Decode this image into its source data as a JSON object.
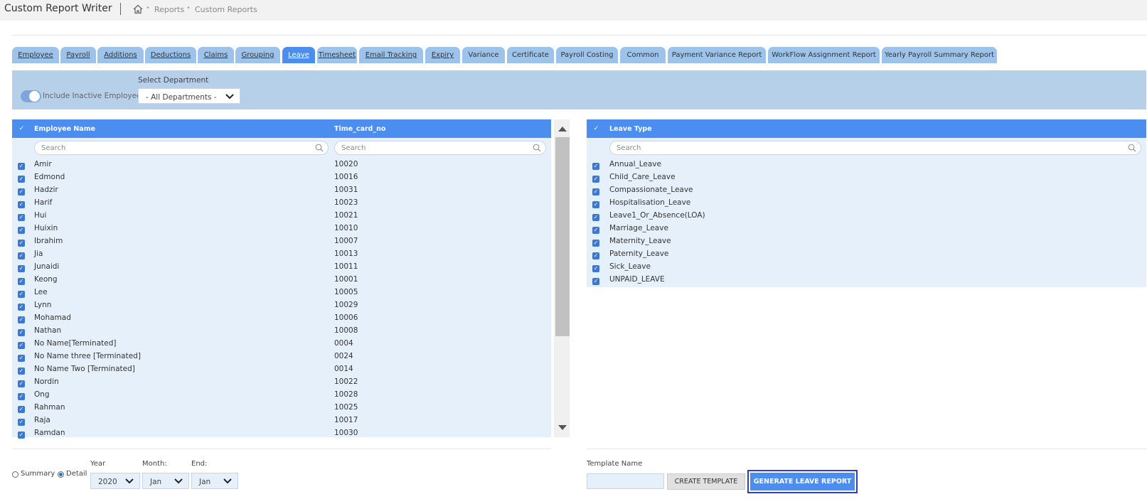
{
  "header": {
    "app_title": "Custom Report Writer",
    "breadcrumb": [
      "Reports",
      "Custom Reports"
    ]
  },
  "tabs": [
    {
      "label": "Employee",
      "active": false
    },
    {
      "label": "Payroll",
      "active": false
    },
    {
      "label": "Additions",
      "active": false
    },
    {
      "label": "Deductions",
      "active": false
    },
    {
      "label": "Claims",
      "active": false
    },
    {
      "label": "Grouping",
      "active": false
    },
    {
      "label": "Leave",
      "active": true
    },
    {
      "label": "Timesheet",
      "active": false
    },
    {
      "label": "Email Tracking",
      "active": false
    },
    {
      "label": "Expiry",
      "active": false
    },
    {
      "label": "Variance",
      "active": false
    },
    {
      "label": "Certificate",
      "active": false
    },
    {
      "label": "Payroll Costing",
      "active": false
    },
    {
      "label": "Common",
      "active": false
    },
    {
      "label": "Payment Variance Report",
      "active": false
    },
    {
      "label": "WorkFlow Assignment Report",
      "active": false
    },
    {
      "label": "Yearly Payroll Summary Report",
      "active": false
    }
  ],
  "filters": {
    "include_inactive_label": "Include Inactive Employee",
    "include_inactive_on": true,
    "department_label": "Select Department",
    "department_value": "- All Departments -"
  },
  "employee_table": {
    "col_name": "Employee Name",
    "col_timecard": "Time_card_no",
    "search_placeholder": "Search",
    "rows": [
      {
        "name": "Amir",
        "time_card": "10020"
      },
      {
        "name": "Edmond",
        "time_card": "10016"
      },
      {
        "name": "Hadzir",
        "time_card": "10031"
      },
      {
        "name": "Harif",
        "time_card": "10023"
      },
      {
        "name": "Hui",
        "time_card": "10021"
      },
      {
        "name": "Huixin",
        "time_card": "10010"
      },
      {
        "name": "Ibrahim",
        "time_card": "10007"
      },
      {
        "name": "Jia",
        "time_card": "10013"
      },
      {
        "name": "Junaidi",
        "time_card": "10011"
      },
      {
        "name": "Keong",
        "time_card": "10001"
      },
      {
        "name": "Lee",
        "time_card": "10005"
      },
      {
        "name": "Lynn",
        "time_card": "10029"
      },
      {
        "name": "Mohamad",
        "time_card": "10006"
      },
      {
        "name": "Nathan",
        "time_card": "10008"
      },
      {
        "name": "No Name[Terminated]",
        "time_card": "0004"
      },
      {
        "name": "No Name three [Terminated]",
        "time_card": "0024"
      },
      {
        "name": "No Name Two [Terminated]",
        "time_card": "0014"
      },
      {
        "name": "Nordin",
        "time_card": "10022"
      },
      {
        "name": "Ong",
        "time_card": "10028"
      },
      {
        "name": "Rahman",
        "time_card": "10025"
      },
      {
        "name": "Raja",
        "time_card": "10017"
      },
      {
        "name": "Ramdan",
        "time_card": "10030"
      }
    ]
  },
  "leave_table": {
    "col_type": "Leave Type",
    "search_placeholder": "Search",
    "rows": [
      "Annual_Leave",
      "Child_Care_Leave",
      "Compassionate_Leave",
      "Hospitalisation_Leave",
      "Leave1_Or_Absence(LOA)",
      "Marriage_Leave",
      "Maternity_Leave",
      "Paternity_Leave",
      "Sick_Leave",
      "UNPAID_LEAVE"
    ]
  },
  "report_options": {
    "summary_label": "Summary",
    "detail_label": "Detail",
    "mode": "Detail",
    "year_label": "Year",
    "year_value": "2020",
    "month_label": "Month:",
    "month_value": "Jan",
    "end_label": "End:",
    "end_value": "Jan"
  },
  "template": {
    "name_label": "Template Name",
    "name_value": "",
    "create_button": "CREATE TEMPLATE",
    "generate_button": "GENERATE LEAVE REPORT"
  },
  "colors": {
    "accent": "#4c8ef0",
    "tab_bg": "#9ec3ea",
    "filter_bar": "#b6d0ea",
    "row_bg": "#e6f0fb"
  }
}
